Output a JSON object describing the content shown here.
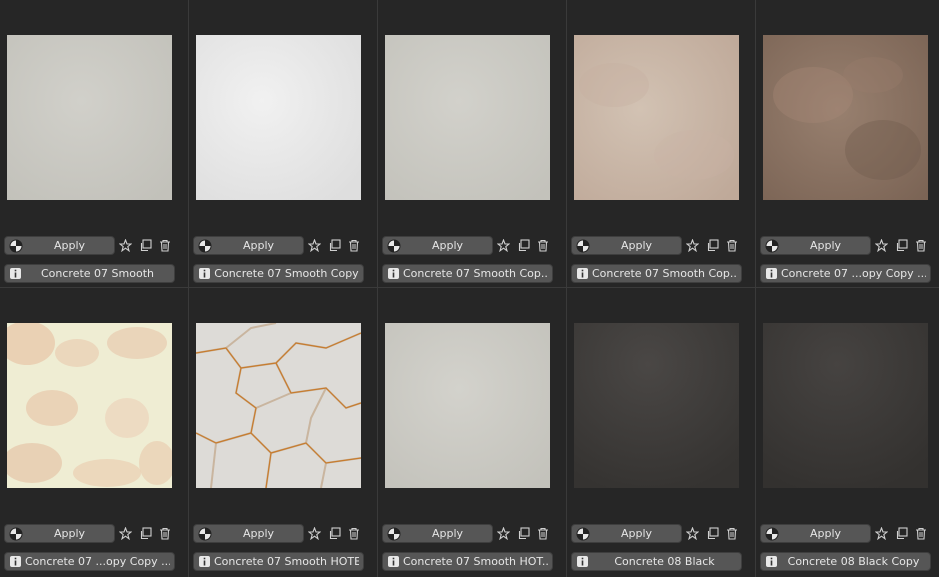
{
  "apply_label": "Apply",
  "icons": {
    "material": "material-icon",
    "favorite": "star-icon",
    "duplicate": "duplicate-icon",
    "delete": "trash-icon",
    "info": "info-icon"
  },
  "assets": [
    {
      "name": "Concrete 07 Smooth",
      "texture": "concrete-light"
    },
    {
      "name": "Concrete 07 Smooth Copy",
      "texture": "concrete-white"
    },
    {
      "name": "Concrete 07 Smooth Cop...",
      "texture": "concrete-light"
    },
    {
      "name": "Concrete 07 Smooth Cop...",
      "texture": "concrete-beige"
    },
    {
      "name": "Concrete 07 ...opy Copy ...",
      "texture": "concrete-brown"
    },
    {
      "name": "Concrete 07 ...opy Copy ...",
      "texture": "concrete-cream"
    },
    {
      "name": "Concrete 07 Smooth HOTE",
      "texture": "marble-veined"
    },
    {
      "name": "Concrete 07 Smooth HOT...",
      "texture": "concrete-light"
    },
    {
      "name": "Concrete 08 Black",
      "texture": "concrete-black"
    },
    {
      "name": "Concrete 08 Black Copy",
      "texture": "concrete-black"
    }
  ],
  "colors": {
    "background": "#2a2a2a",
    "button": "#565656",
    "concrete-light": "#c9c8c1",
    "concrete-white": "#e9e9e9",
    "concrete-beige": "#c8b5a4",
    "concrete-brown": "#8c7463",
    "concrete-cream": "#ecead0",
    "marble-veined": "#dcdad6",
    "concrete-black": "#3c3a38"
  }
}
